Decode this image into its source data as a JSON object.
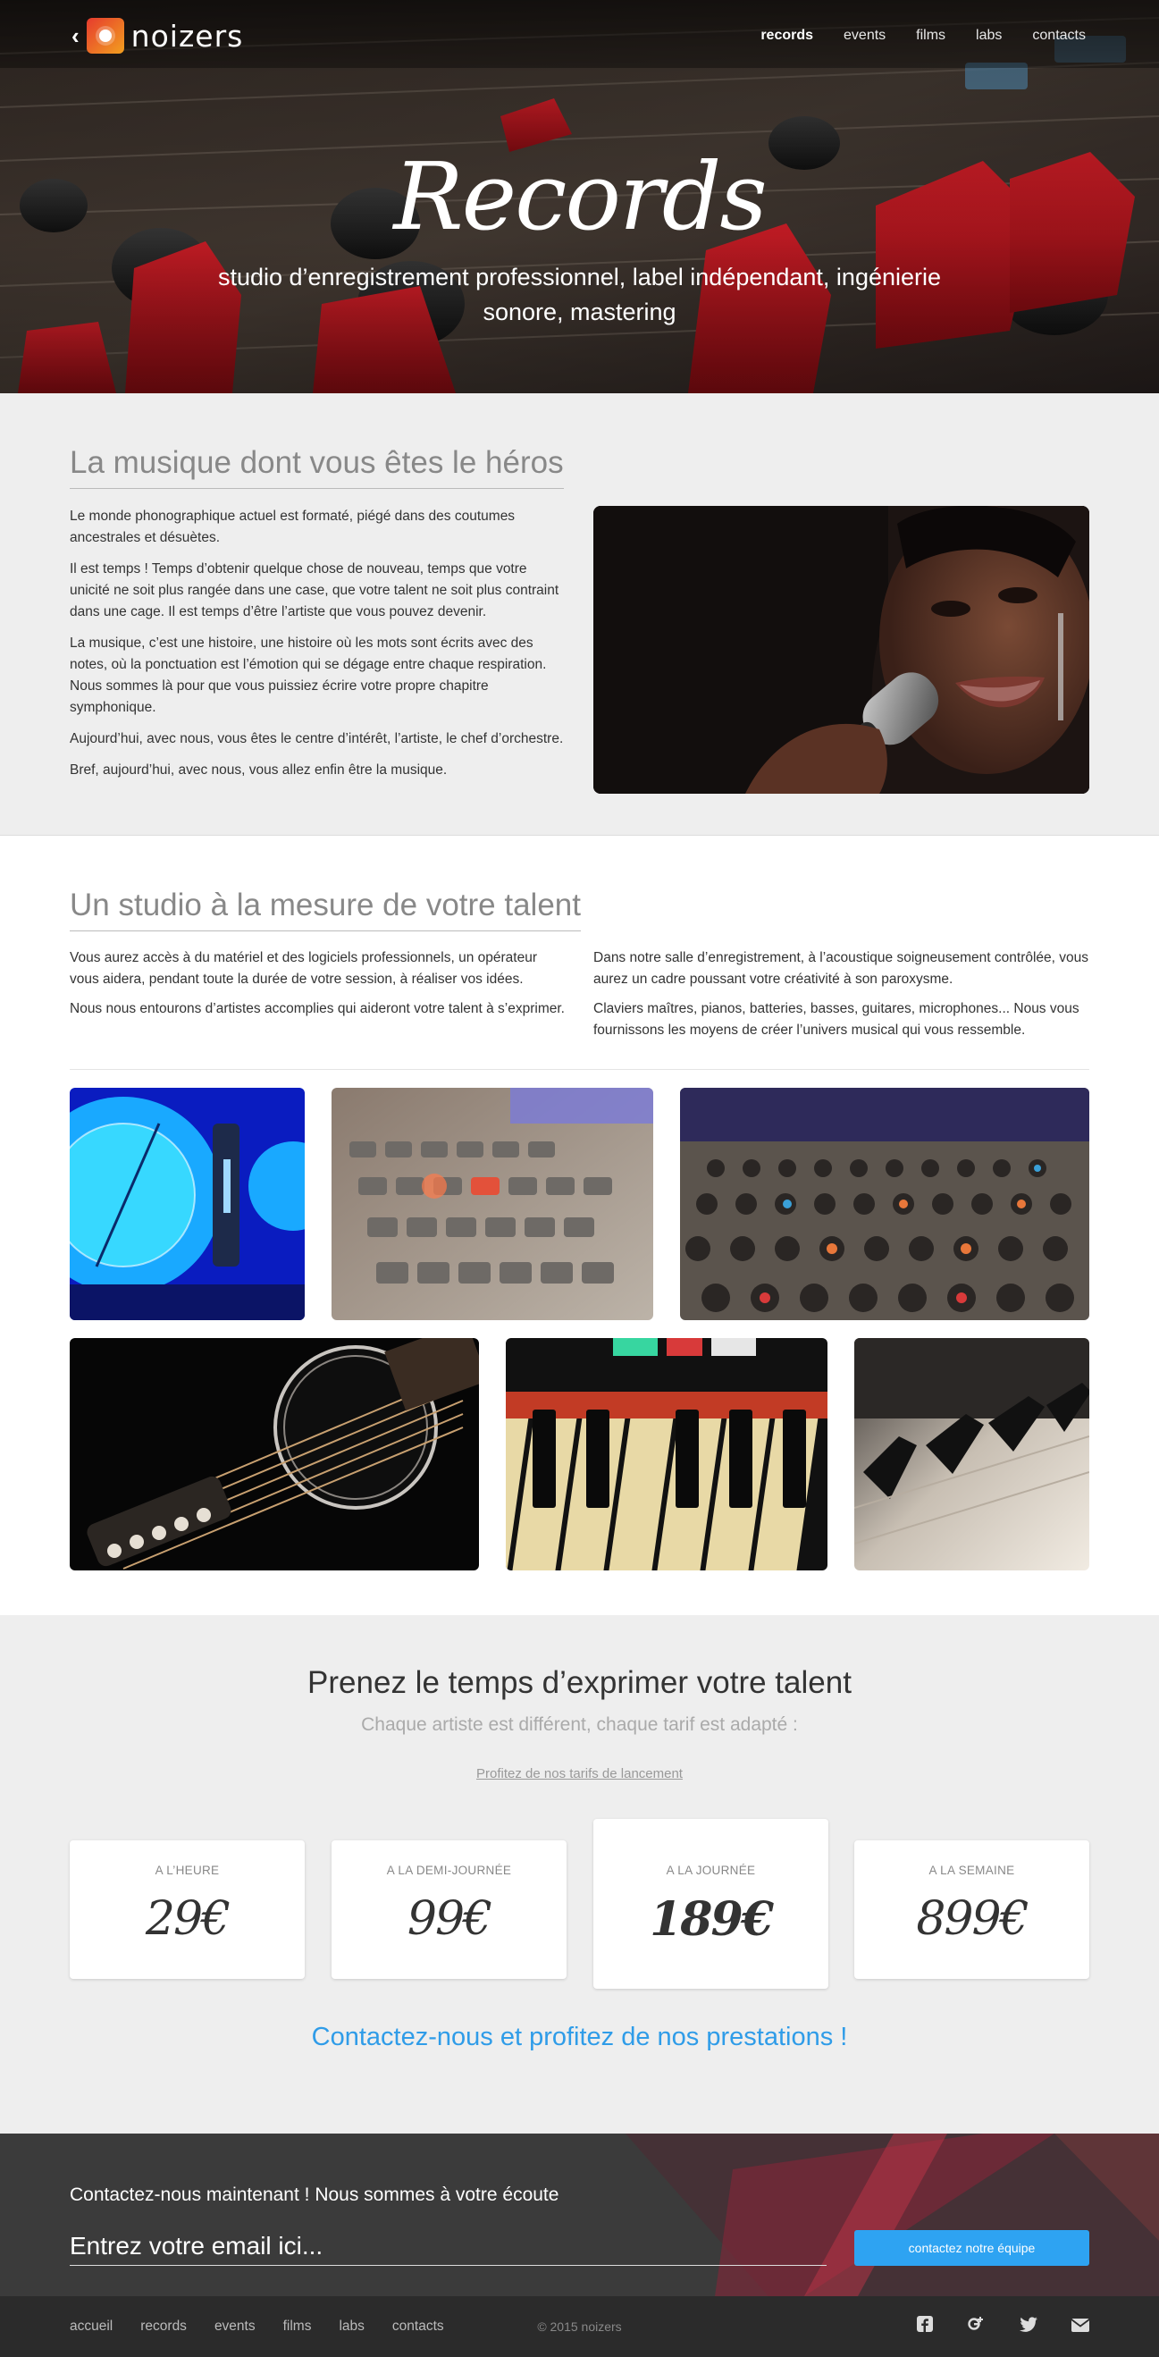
{
  "nav": {
    "brand": "noizers",
    "items": [
      {
        "label": "records",
        "active": true
      },
      {
        "label": "events",
        "active": false
      },
      {
        "label": "films",
        "active": false
      },
      {
        "label": "labs",
        "active": false
      },
      {
        "label": "contacts",
        "active": false
      }
    ]
  },
  "hero": {
    "title": "Records",
    "subtitle": "studio d’enregistrement professionnel, label indépendant, ingénierie sonore, mastering"
  },
  "intro": {
    "title": "La musique dont vous êtes le héros",
    "paragraphs": [
      "Le monde phonographique actuel est formaté, piégé dans des coutumes ancestrales et désuètes.",
      "Il est temps ! Temps d’obtenir quelque chose de nouveau, temps que votre unicité ne soit plus rangée dans une case, que votre talent ne soit plus contraint dans une cage. Il est temps d’être l’artiste que vous pouvez devenir.",
      "La musique, c’est une histoire, une histoire où les mots sont écrits avec des notes, où la ponctuation est l’émotion qui se dégage entre chaque respiration. Nous sommes là pour que vous puissiez écrire votre propre chapitre symphonique.",
      "Aujourd’hui, avec nous, vous êtes le centre d’intérêt, l’artiste, le chef d’orchestre.",
      "Bref, aujourd’hui, avec nous, vous allez enfin être la musique."
    ]
  },
  "studio": {
    "title": "Un studio à la mesure de votre talent",
    "left": [
      "Vous aurez accès à du matériel et des logiciels professionnels, un opérateur vous aidera, pendant toute la durée de votre session, à réaliser vos idées.",
      "Nous nous entourons d’artistes accomplies qui aideront votre talent à s’exprimer."
    ],
    "right": [
      "Dans notre salle d’enregistrement, à l’acoustique soigneusement contrôlée, vous aurez un cadre poussant votre créativité à son paroxysme.",
      "Claviers maîtres, pianos, batteries, basses, guitares, microphones... Nous vous fournissons les moyens de créer l’univers musical qui vous ressemble."
    ]
  },
  "pricing": {
    "headline": "Prenez le temps d’exprimer votre talent",
    "subline": "Chaque artiste est différent, chaque tarif est adapté :",
    "offer_link": "Profitez de nos tarifs de lancement",
    "plans": [
      {
        "label": "A L’HEURE",
        "price": "29€"
      },
      {
        "label": "A LA DEMI-JOURNÉE",
        "price": "99€"
      },
      {
        "label": "A LA JOURNÉE",
        "price": "189€"
      },
      {
        "label": "A LA SEMAINE",
        "price": "899€"
      }
    ],
    "cta": "Contactez-nous et profitez de nos prestations !"
  },
  "contact": {
    "title": "Contactez-nous maintenant ! Nous sommes à votre écoute",
    "email_placeholder": "Entrez votre email ici...",
    "button": "contactez notre équipe"
  },
  "footer": {
    "links": [
      "accueil",
      "records",
      "events",
      "films",
      "labs",
      "contacts"
    ],
    "copyright": "© 2015 noizers",
    "social": [
      "facebook-icon",
      "google-plus-icon",
      "twitter-icon",
      "mail-icon"
    ]
  },
  "colors": {
    "accent": "#2ea3f2",
    "cta_text": "#2f9ce8",
    "section_bg": "#eeeeee",
    "footer_bg": "#2b2b2b"
  }
}
